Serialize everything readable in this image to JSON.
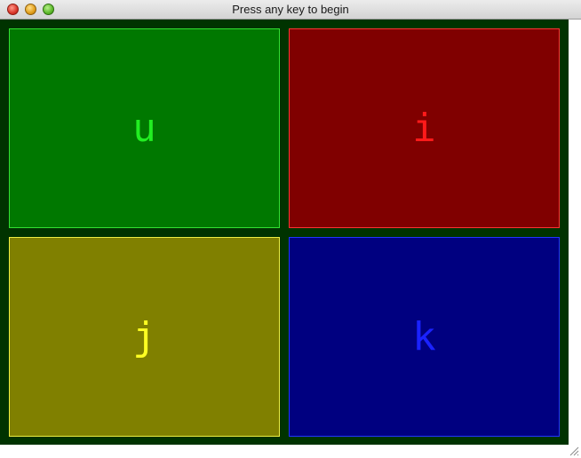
{
  "window": {
    "title": "Press any key to begin"
  },
  "icons": {
    "close": "close-button-red",
    "minimize": "minimize-button-yellow",
    "zoom": "zoom-button-green",
    "resize": "resize-grip-icon"
  },
  "colors": {
    "canvas_bg": "#003300",
    "green_fill": "#007800",
    "red_fill": "#800000",
    "yellow_fill": "#808000",
    "blue_fill": "#000080"
  },
  "quadrants": [
    {
      "key": "u",
      "color": "green"
    },
    {
      "key": "i",
      "color": "red"
    },
    {
      "key": "j",
      "color": "yellow"
    },
    {
      "key": "k",
      "color": "blue"
    }
  ]
}
